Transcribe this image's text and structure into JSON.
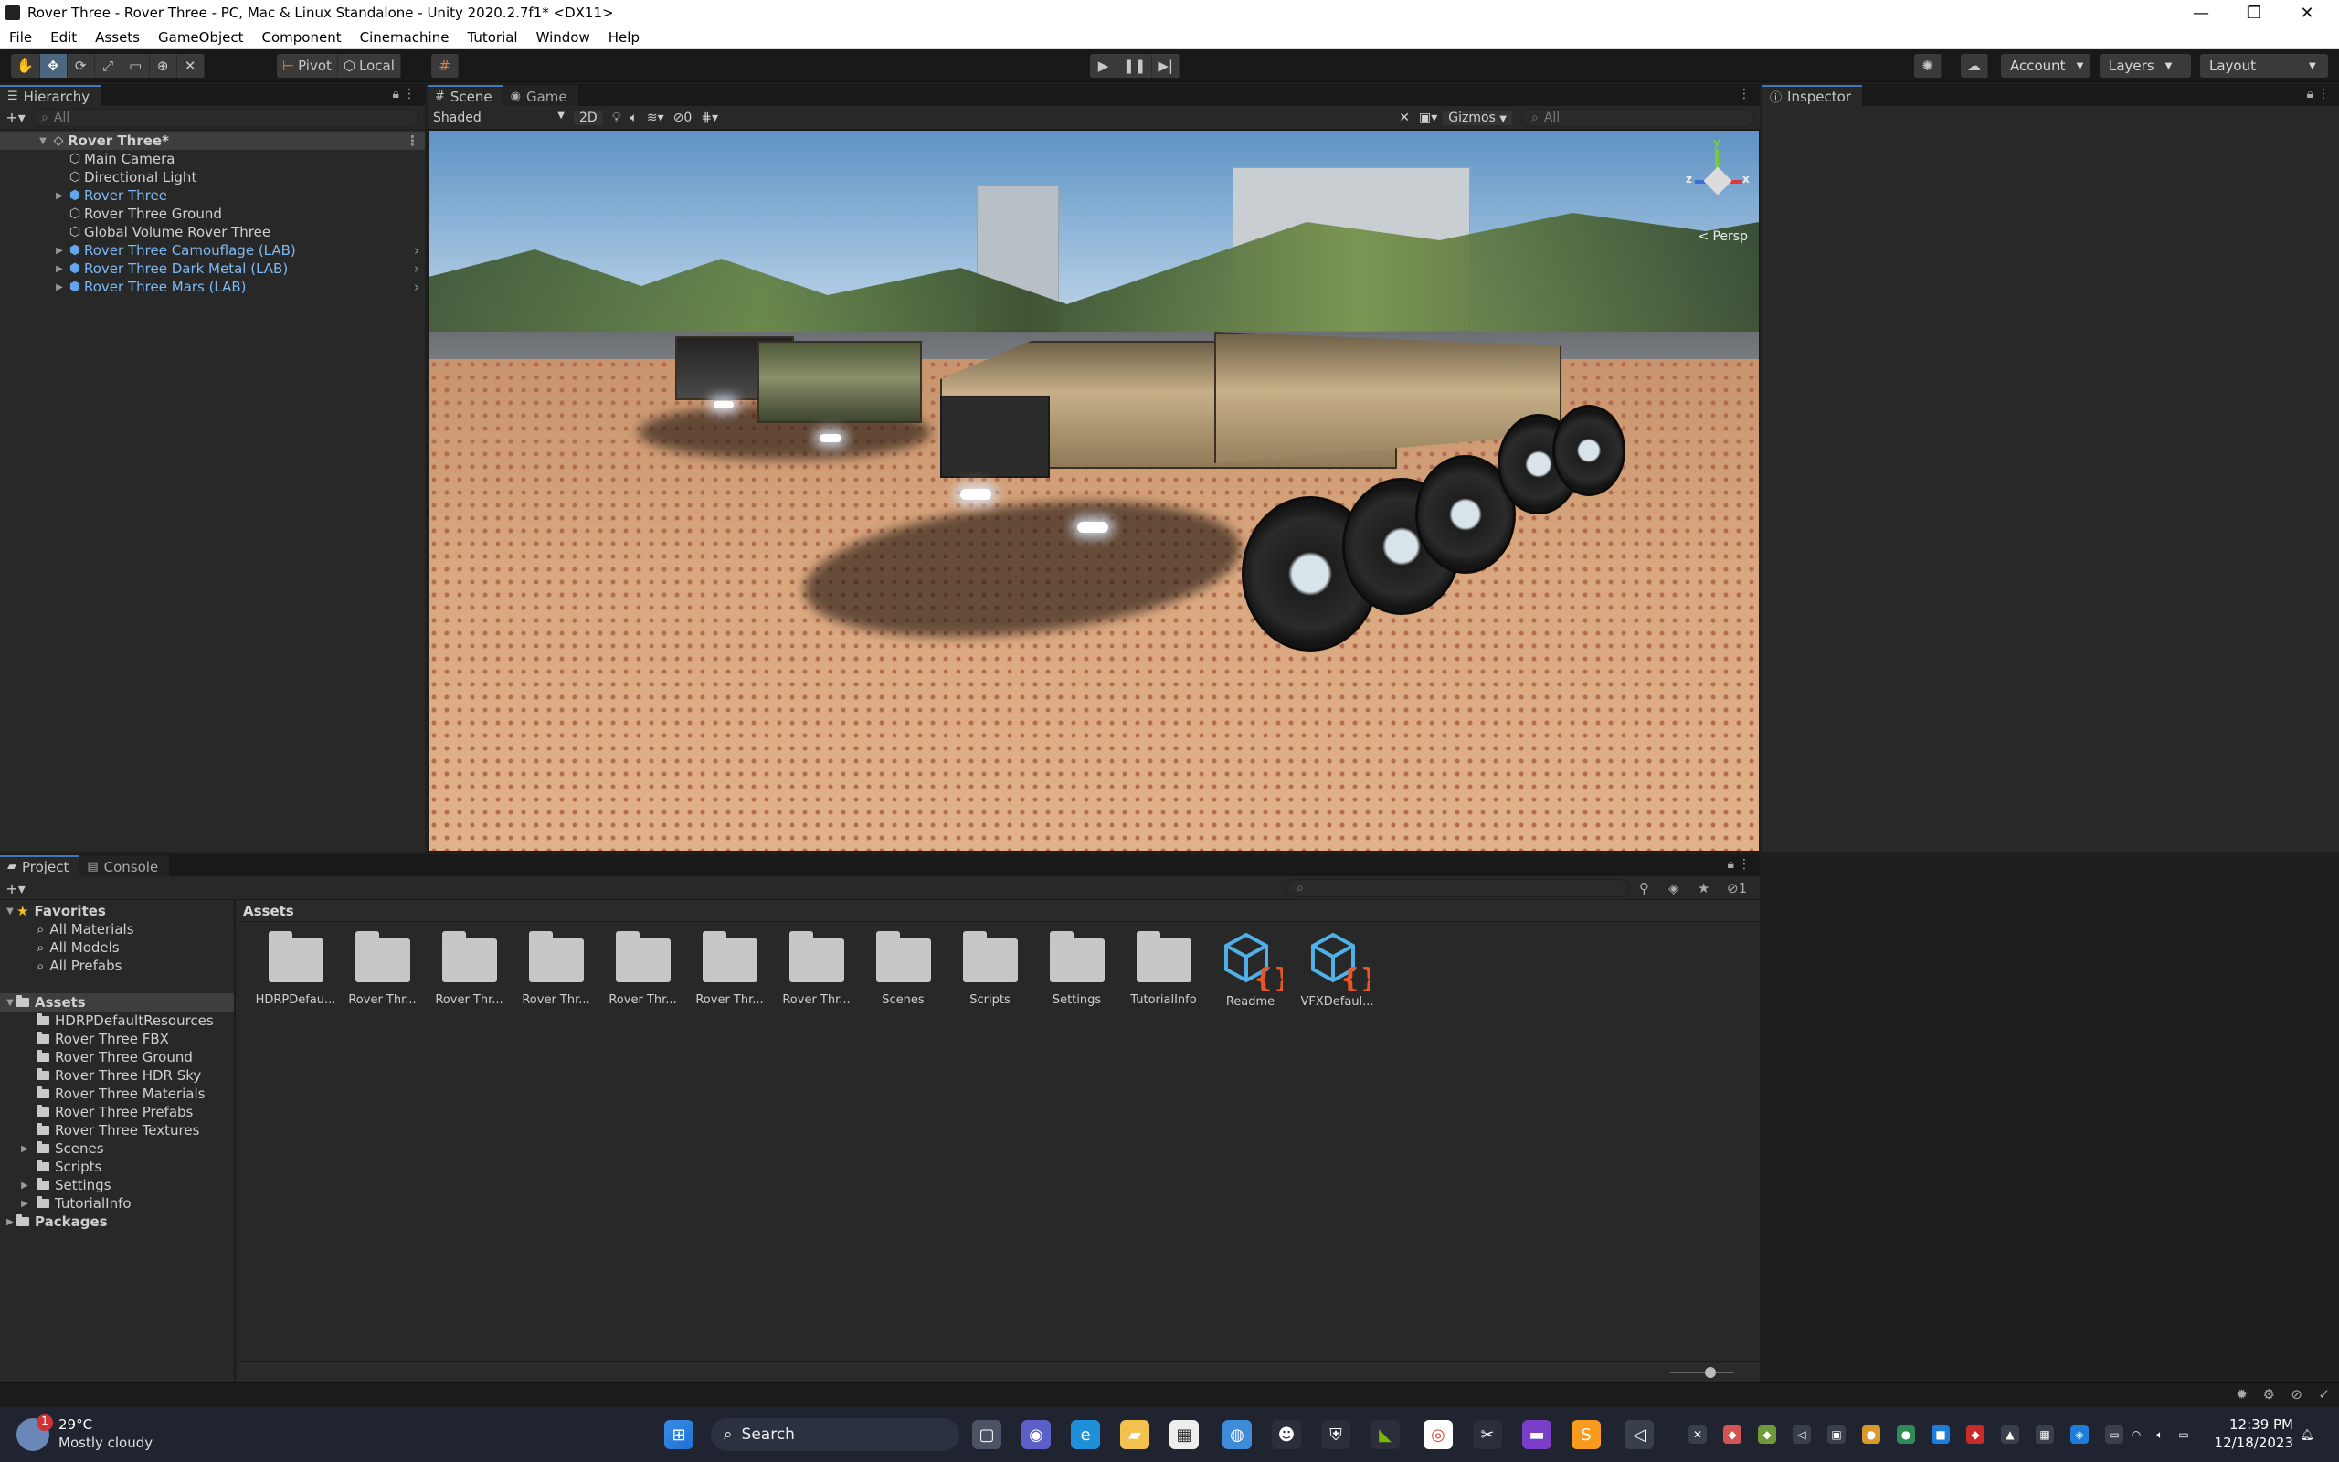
{
  "window": {
    "title": "Rover Three - Rover Three - PC, Mac & Linux Standalone - Unity 2020.2.7f1* <DX11>",
    "controls": [
      "—",
      "❐",
      "✕"
    ]
  },
  "menu": [
    "File",
    "Edit",
    "Assets",
    "GameObject",
    "Component",
    "Cinemachine",
    "Tutorial",
    "Window",
    "Help"
  ],
  "toolbar": {
    "pivot": "Pivot",
    "local": "Local",
    "account": "Account",
    "layers": "Layers",
    "layout": "Layout"
  },
  "hierarchy": {
    "tab": "Hierarchy",
    "search_placeholder": "All",
    "scene": "Rover Three*",
    "items": [
      {
        "label": "Main Camera",
        "prefab": false,
        "expandable": false
      },
      {
        "label": "Directional Light",
        "prefab": false,
        "expandable": false
      },
      {
        "label": "Rover Three",
        "prefab": true,
        "expandable": true
      },
      {
        "label": "Rover Three Ground",
        "prefab": false,
        "expandable": false
      },
      {
        "label": "Global Volume Rover Three",
        "prefab": false,
        "expandable": false
      },
      {
        "label": "Rover Three Camouflage (LAB)",
        "prefab": true,
        "expandable": true
      },
      {
        "label": "Rover Three Dark Metal (LAB)",
        "prefab": true,
        "expandable": true
      },
      {
        "label": "Rover Three Mars (LAB)",
        "prefab": true,
        "expandable": true
      }
    ]
  },
  "scene": {
    "tabs": [
      "Scene",
      "Game"
    ],
    "shading": "Shaded",
    "mode_2d": "2D",
    "hidden_count": "0",
    "gizmos": "Gizmos",
    "search_placeholder": "All",
    "persp": "< Persp",
    "axes": {
      "y": "y",
      "x": "x",
      "z": "z"
    }
  },
  "inspector": {
    "tab": "Inspector"
  },
  "project": {
    "tabs": [
      "Project",
      "Console"
    ],
    "visible_count": "1",
    "favorites_label": "Favorites",
    "favorites": [
      "All Materials",
      "All Models",
      "All Prefabs"
    ],
    "assets_label": "Assets",
    "asset_folders": [
      {
        "label": "HDRPDefaultResources",
        "expandable": false
      },
      {
        "label": "Rover Three FBX",
        "expandable": false
      },
      {
        "label": "Rover Three Ground",
        "expandable": false
      },
      {
        "label": "Rover Three HDR Sky",
        "expandable": false
      },
      {
        "label": "Rover Three Materials",
        "expandable": false
      },
      {
        "label": "Rover Three Prefabs",
        "expandable": false
      },
      {
        "label": "Rover Three Textures",
        "expandable": false
      },
      {
        "label": "Scenes",
        "expandable": true
      },
      {
        "label": "Scripts",
        "expandable": false
      },
      {
        "label": "Settings",
        "expandable": true
      },
      {
        "label": "TutorialInfo",
        "expandable": true
      }
    ],
    "packages_label": "Packages",
    "breadcrumb": "Assets",
    "grid": [
      {
        "label": "HDRPDefau...",
        "type": "folder"
      },
      {
        "label": "Rover Thr...",
        "type": "folder"
      },
      {
        "label": "Rover Thr...",
        "type": "folder"
      },
      {
        "label": "Rover Thr...",
        "type": "folder"
      },
      {
        "label": "Rover Thr...",
        "type": "folder"
      },
      {
        "label": "Rover Thr...",
        "type": "folder"
      },
      {
        "label": "Rover Thr...",
        "type": "folder"
      },
      {
        "label": "Scenes",
        "type": "folder"
      },
      {
        "label": "Scripts",
        "type": "folder"
      },
      {
        "label": "Settings",
        "type": "folder"
      },
      {
        "label": "TutorialInfo",
        "type": "folder"
      },
      {
        "label": "Readme",
        "type": "asset"
      },
      {
        "label": "VFXDefaul...",
        "type": "asset"
      }
    ]
  },
  "taskbar": {
    "weather_temp": "29°C",
    "weather_desc": "Mostly cloudy",
    "weather_badge": "1",
    "search": "Search",
    "time": "12:39 PM",
    "date": "12/18/2023"
  },
  "colors": {
    "accent": "#3a79bb",
    "prefab_text": "#7db9f2",
    "script_icon_blue": "#4fb1e8",
    "script_icon_orange": "#e8562a"
  }
}
